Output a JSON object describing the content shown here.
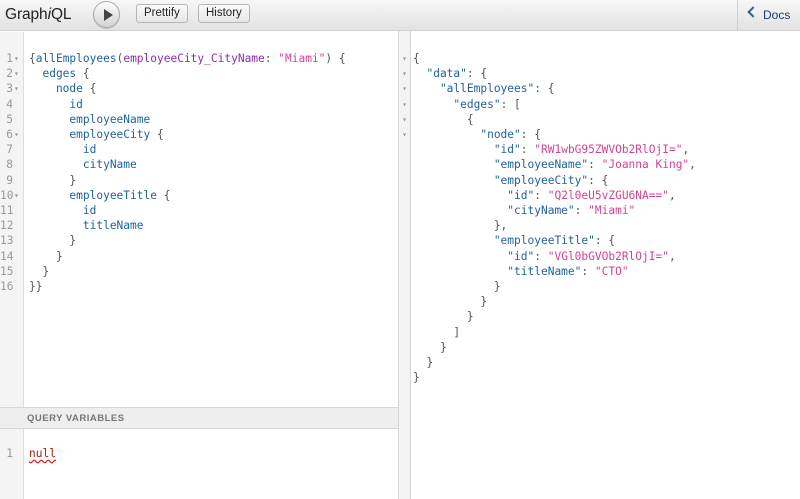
{
  "header": {
    "logo_prefix": "Graph",
    "logo_italic": "i",
    "logo_suffix": "QL",
    "prettify_label": "Prettify",
    "history_label": "History",
    "docs_label": "Docs"
  },
  "query": {
    "lines": [
      [
        [
          "c-punc",
          "{"
        ],
        [
          "c-def",
          "allEmployees"
        ],
        [
          "c-punc",
          "("
        ],
        [
          "c-attr",
          "employeeCity_CityName"
        ],
        [
          "c-punc",
          ": "
        ],
        [
          "c-str",
          "\"Miami\""
        ],
        [
          "c-punc",
          ") {"
        ]
      ],
      [
        [
          "c-def",
          "  edges "
        ],
        [
          "c-punc",
          "{"
        ]
      ],
      [
        [
          "c-def",
          "    node "
        ],
        [
          "c-punc",
          "{"
        ]
      ],
      [
        [
          "c-def",
          "      id"
        ]
      ],
      [
        [
          "c-def",
          "      employeeName"
        ]
      ],
      [
        [
          "c-def",
          "      employeeCity "
        ],
        [
          "c-punc",
          "{"
        ]
      ],
      [
        [
          "c-def",
          "        id"
        ]
      ],
      [
        [
          "c-def",
          "        cityName"
        ]
      ],
      [
        [
          "c-punc",
          "      }"
        ]
      ],
      [
        [
          "c-def",
          "      employeeTitle "
        ],
        [
          "c-punc",
          "{"
        ]
      ],
      [
        [
          "c-def",
          "        id"
        ]
      ],
      [
        [
          "c-def",
          "        titleName"
        ]
      ],
      [
        [
          "c-punc",
          "      }"
        ]
      ],
      [
        [
          "c-punc",
          "    }"
        ]
      ],
      [
        [
          "c-punc",
          "  }"
        ]
      ],
      [
        [
          "c-punc",
          "}}"
        ]
      ]
    ],
    "line_numbers": [
      "1",
      "2",
      "3",
      "4",
      "5",
      "6",
      "7",
      "8",
      "9",
      "10",
      "11",
      "12",
      "13",
      "14",
      "15",
      "16"
    ],
    "foldable_lines": [
      0,
      1,
      2,
      5,
      9
    ]
  },
  "variables": {
    "header_label": "QUERY VARIABLES",
    "line_number": "1",
    "value": "null"
  },
  "result": {
    "lines": [
      [
        [
          "c-punc",
          "{"
        ]
      ],
      [
        [
          "c-key",
          "  \"data\""
        ],
        [
          "c-punc",
          ": {"
        ]
      ],
      [
        [
          "c-key",
          "    \"allEmployees\""
        ],
        [
          "c-punc",
          ": {"
        ]
      ],
      [
        [
          "c-key",
          "      \"edges\""
        ],
        [
          "c-punc",
          ": ["
        ]
      ],
      [
        [
          "c-punc",
          "        {"
        ]
      ],
      [
        [
          "c-key",
          "          \"node\""
        ],
        [
          "c-punc",
          ": {"
        ]
      ],
      [
        [
          "c-key",
          "            \"id\""
        ],
        [
          "c-punc",
          ": "
        ],
        [
          "c-str",
          "\"RW1wbG95ZWVOb2RlOjI=\""
        ],
        [
          "c-punc",
          ","
        ]
      ],
      [
        [
          "c-key",
          "            \"employeeName\""
        ],
        [
          "c-punc",
          ": "
        ],
        [
          "c-str",
          "\"Joanna King\""
        ],
        [
          "c-punc",
          ","
        ]
      ],
      [
        [
          "c-key",
          "            \"employeeCity\""
        ],
        [
          "c-punc",
          ": {"
        ]
      ],
      [
        [
          "c-key",
          "              \"id\""
        ],
        [
          "c-punc",
          ": "
        ],
        [
          "c-str",
          "\"Q2l0eU5vZGU6NA==\""
        ],
        [
          "c-punc",
          ","
        ]
      ],
      [
        [
          "c-key",
          "              \"cityName\""
        ],
        [
          "c-punc",
          ": "
        ],
        [
          "c-str",
          "\"Miami\""
        ]
      ],
      [
        [
          "c-punc",
          "            },"
        ]
      ],
      [
        [
          "c-key",
          "            \"employeeTitle\""
        ],
        [
          "c-punc",
          ": {"
        ]
      ],
      [
        [
          "c-key",
          "              \"id\""
        ],
        [
          "c-punc",
          ": "
        ],
        [
          "c-str",
          "\"VGl0bGVOb2RlOjI=\""
        ],
        [
          "c-punc",
          ","
        ]
      ],
      [
        [
          "c-key",
          "              \"titleName\""
        ],
        [
          "c-punc",
          ": "
        ],
        [
          "c-str",
          "\"CTO\""
        ]
      ],
      [
        [
          "c-punc",
          "            }"
        ]
      ],
      [
        [
          "c-punc",
          "          }"
        ]
      ],
      [
        [
          "c-punc",
          "        }"
        ]
      ],
      [
        [
          "c-punc",
          "      ]"
        ]
      ],
      [
        [
          "c-punc",
          "    }"
        ]
      ],
      [
        [
          "c-punc",
          "  }"
        ]
      ],
      [
        [
          "c-punc",
          "}"
        ]
      ]
    ],
    "foldable_lines": [
      0,
      1,
      2,
      3,
      4,
      5
    ]
  },
  "colors": {
    "def": "#1f61a0",
    "attr": "#8b2bb9",
    "string": "#d64292",
    "punctuation": "#555555",
    "error": "#b11a04"
  },
  "icons": {
    "run": "play-triangle-icon",
    "docs": "chevron-left-icon",
    "fold": "fold-arrow-icon"
  }
}
